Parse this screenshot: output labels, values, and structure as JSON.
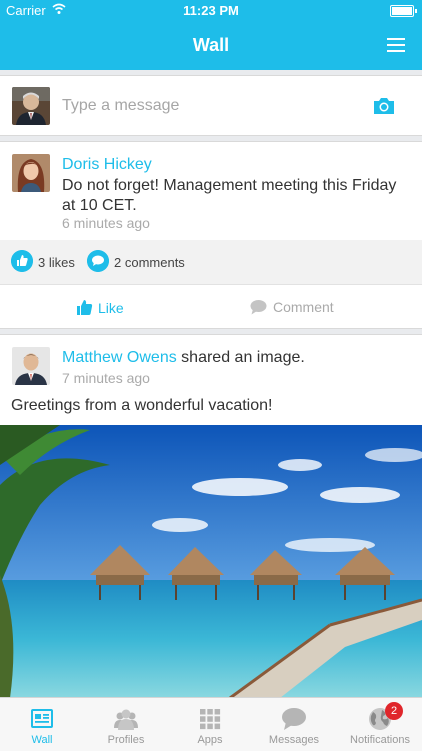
{
  "status_bar": {
    "carrier": "Carrier",
    "time": "11:23 PM"
  },
  "header": {
    "title": "Wall",
    "menu_icon": "hamburger-menu-icon"
  },
  "composer": {
    "placeholder": "Type a message",
    "camera_icon": "camera-icon"
  },
  "posts": [
    {
      "author": "Doris Hickey",
      "text": "Do not forget! Management meeting this Friday at 10 CET.",
      "time": "6 minutes ago",
      "likes": "3 likes",
      "comments": "2 comments",
      "like_label": "Like",
      "comment_label": "Comment"
    },
    {
      "author": "Matthew Owens",
      "action": "shared an image.",
      "time": "7 minutes ago",
      "text": "Greetings from a wonderful vacation!"
    }
  ],
  "tabs": [
    {
      "label": "Wall",
      "icon": "wall-icon",
      "active": true
    },
    {
      "label": "Profiles",
      "icon": "profiles-icon"
    },
    {
      "label": "Apps",
      "icon": "apps-grid-icon"
    },
    {
      "label": "Messages",
      "icon": "messages-icon"
    },
    {
      "label": "Notifications",
      "icon": "globe-icon",
      "badge": "2"
    }
  ],
  "colors": {
    "accent": "#1ebde9",
    "badge": "#e0262b"
  }
}
